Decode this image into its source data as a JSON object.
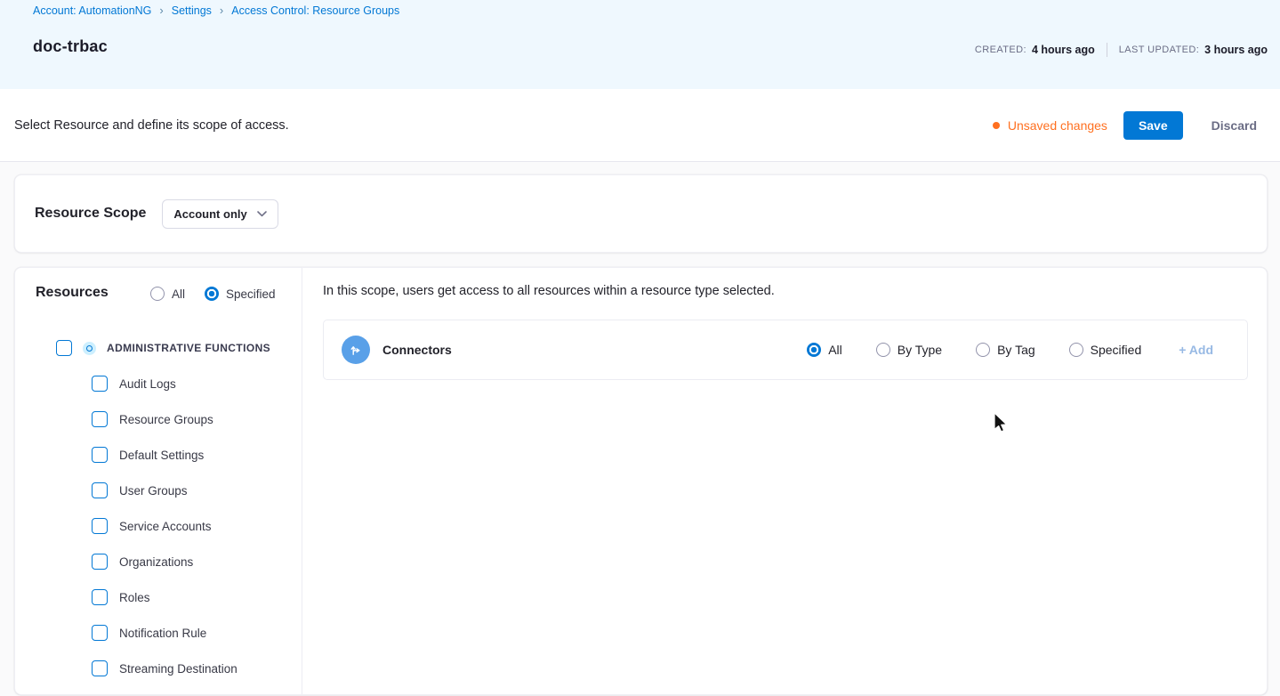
{
  "breadcrumb": {
    "account": "Account: AutomationNG",
    "settings": "Settings",
    "current": "Access Control: Resource Groups",
    "separator": "›"
  },
  "header": {
    "title": "doc-trbac",
    "created_label": "CREATED:",
    "created_value": "4 hours ago",
    "updated_label": "LAST UPDATED:",
    "updated_value": "3 hours ago"
  },
  "toolbar": {
    "description": "Select Resource and define its scope of access.",
    "unsaved_changes_label": "Unsaved changes",
    "save_label": "Save",
    "discard_label": "Discard"
  },
  "resource_scope": {
    "label": "Resource Scope",
    "selected_option": "Account only"
  },
  "resources_panel": {
    "title": "Resources",
    "mode_options": [
      {
        "label": "All",
        "selected": false
      },
      {
        "label": "Specified",
        "selected": true
      }
    ],
    "group": {
      "label": "ADMINISTRATIVE FUNCTIONS",
      "checked": false
    },
    "items": [
      {
        "label": "Audit Logs",
        "checked": false
      },
      {
        "label": "Resource Groups",
        "checked": false
      },
      {
        "label": "Default Settings",
        "checked": false
      },
      {
        "label": "User Groups",
        "checked": false
      },
      {
        "label": "Service Accounts",
        "checked": false
      },
      {
        "label": "Organizations",
        "checked": false
      },
      {
        "label": "Roles",
        "checked": false
      },
      {
        "label": "Notification Rule",
        "checked": false
      },
      {
        "label": "Streaming Destination",
        "checked": false
      }
    ]
  },
  "main": {
    "scope_note": "In this scope, users get access to all resources within a resource type selected.",
    "resource_row": {
      "name": "Connectors",
      "options": [
        {
          "label": "All",
          "selected": true
        },
        {
          "label": "By Type",
          "selected": false
        },
        {
          "label": "By Tag",
          "selected": false
        },
        {
          "label": "Specified",
          "selected": false
        }
      ],
      "add_label": "+ Add"
    }
  },
  "colors": {
    "primary_blue": "#0278d5",
    "unsaved_orange": "#ff7020",
    "header_bg": "#eff8fe",
    "avatar_blue": "#59a0e8",
    "add_link_blue": "#97b9e4"
  }
}
